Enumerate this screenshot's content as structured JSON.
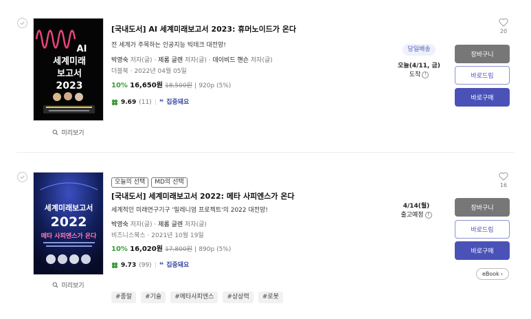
{
  "products": [
    {
      "badges": [],
      "title": "[국내도서] AI 세계미래보고서 2023: 휴머노이드가 온다",
      "subtitle": "전 세계가 주목하는 인공지능 빅테크 대전망!",
      "authors": [
        {
          "name": "박영숙",
          "role": " 저자(글)",
          "sep": " · "
        },
        {
          "name": "제롬 글렌",
          "role": " 저자(글)",
          "sep": " · "
        },
        {
          "name": "데이비드 핸슨",
          "role": " 저자(글)",
          "sep": ""
        }
      ],
      "publisher": "더블북",
      "pub_date": "2022년 04월 05일",
      "discount": "10%",
      "sale_price": "16,650원",
      "orig_price": "18,500원",
      "points": "920p (5%)",
      "rating": "9.69",
      "review_count": "(11)",
      "review_label": "집중돼요",
      "shipping_pill": "당일배송",
      "delivery_date": "오늘(4/11, 금)",
      "delivery_status": "도착",
      "likes": "20",
      "preview_label": "미리보기",
      "cover": {
        "title_line1": "AI",
        "title_line2": "세계미래",
        "title_line3": "보고서",
        "year": "2023"
      }
    },
    {
      "badges": [
        "오늘의 선택",
        "MD의 선택"
      ],
      "title": "[국내도서] 세계미래보고서 2022: 메타 사피엔스가 온다",
      "subtitle": "세계적인 미래연구기구 '밀레니엄 프로젝트'의 2022 대전망!",
      "authors": [
        {
          "name": "박영숙",
          "role": " 저자(글)",
          "sep": " · "
        },
        {
          "name": "제롬 글렌",
          "role": " 저자(글)",
          "sep": ""
        }
      ],
      "publisher": "비즈니스북스",
      "pub_date": "2021년 10월 19일",
      "discount": "10%",
      "sale_price": "16,020원",
      "orig_price": "17,800원",
      "points": "890p (5%)",
      "rating": "9.73",
      "review_count": "(99)",
      "review_label": "집중돼요",
      "delivery_date": "4/14(월)",
      "delivery_status": "출고예정",
      "likes": "16",
      "preview_label": "미리보기",
      "ebook_label": "eBook",
      "tags": [
        "#종말",
        "#기술",
        "#메타사피엔스",
        "#상상력",
        "#로봇"
      ],
      "cover": {
        "title_line1": "세계미래보고서",
        "year": "2022",
        "title_line2": "메타 사피엔스가 온다"
      }
    }
  ],
  "buttons": {
    "cart": "장바구니",
    "buy_now": "바로드림",
    "purchase": "바로구매"
  },
  "colors": {
    "accent": "#4a52b8",
    "discount": "#3c9a3c",
    "cart_button": "#777777"
  }
}
